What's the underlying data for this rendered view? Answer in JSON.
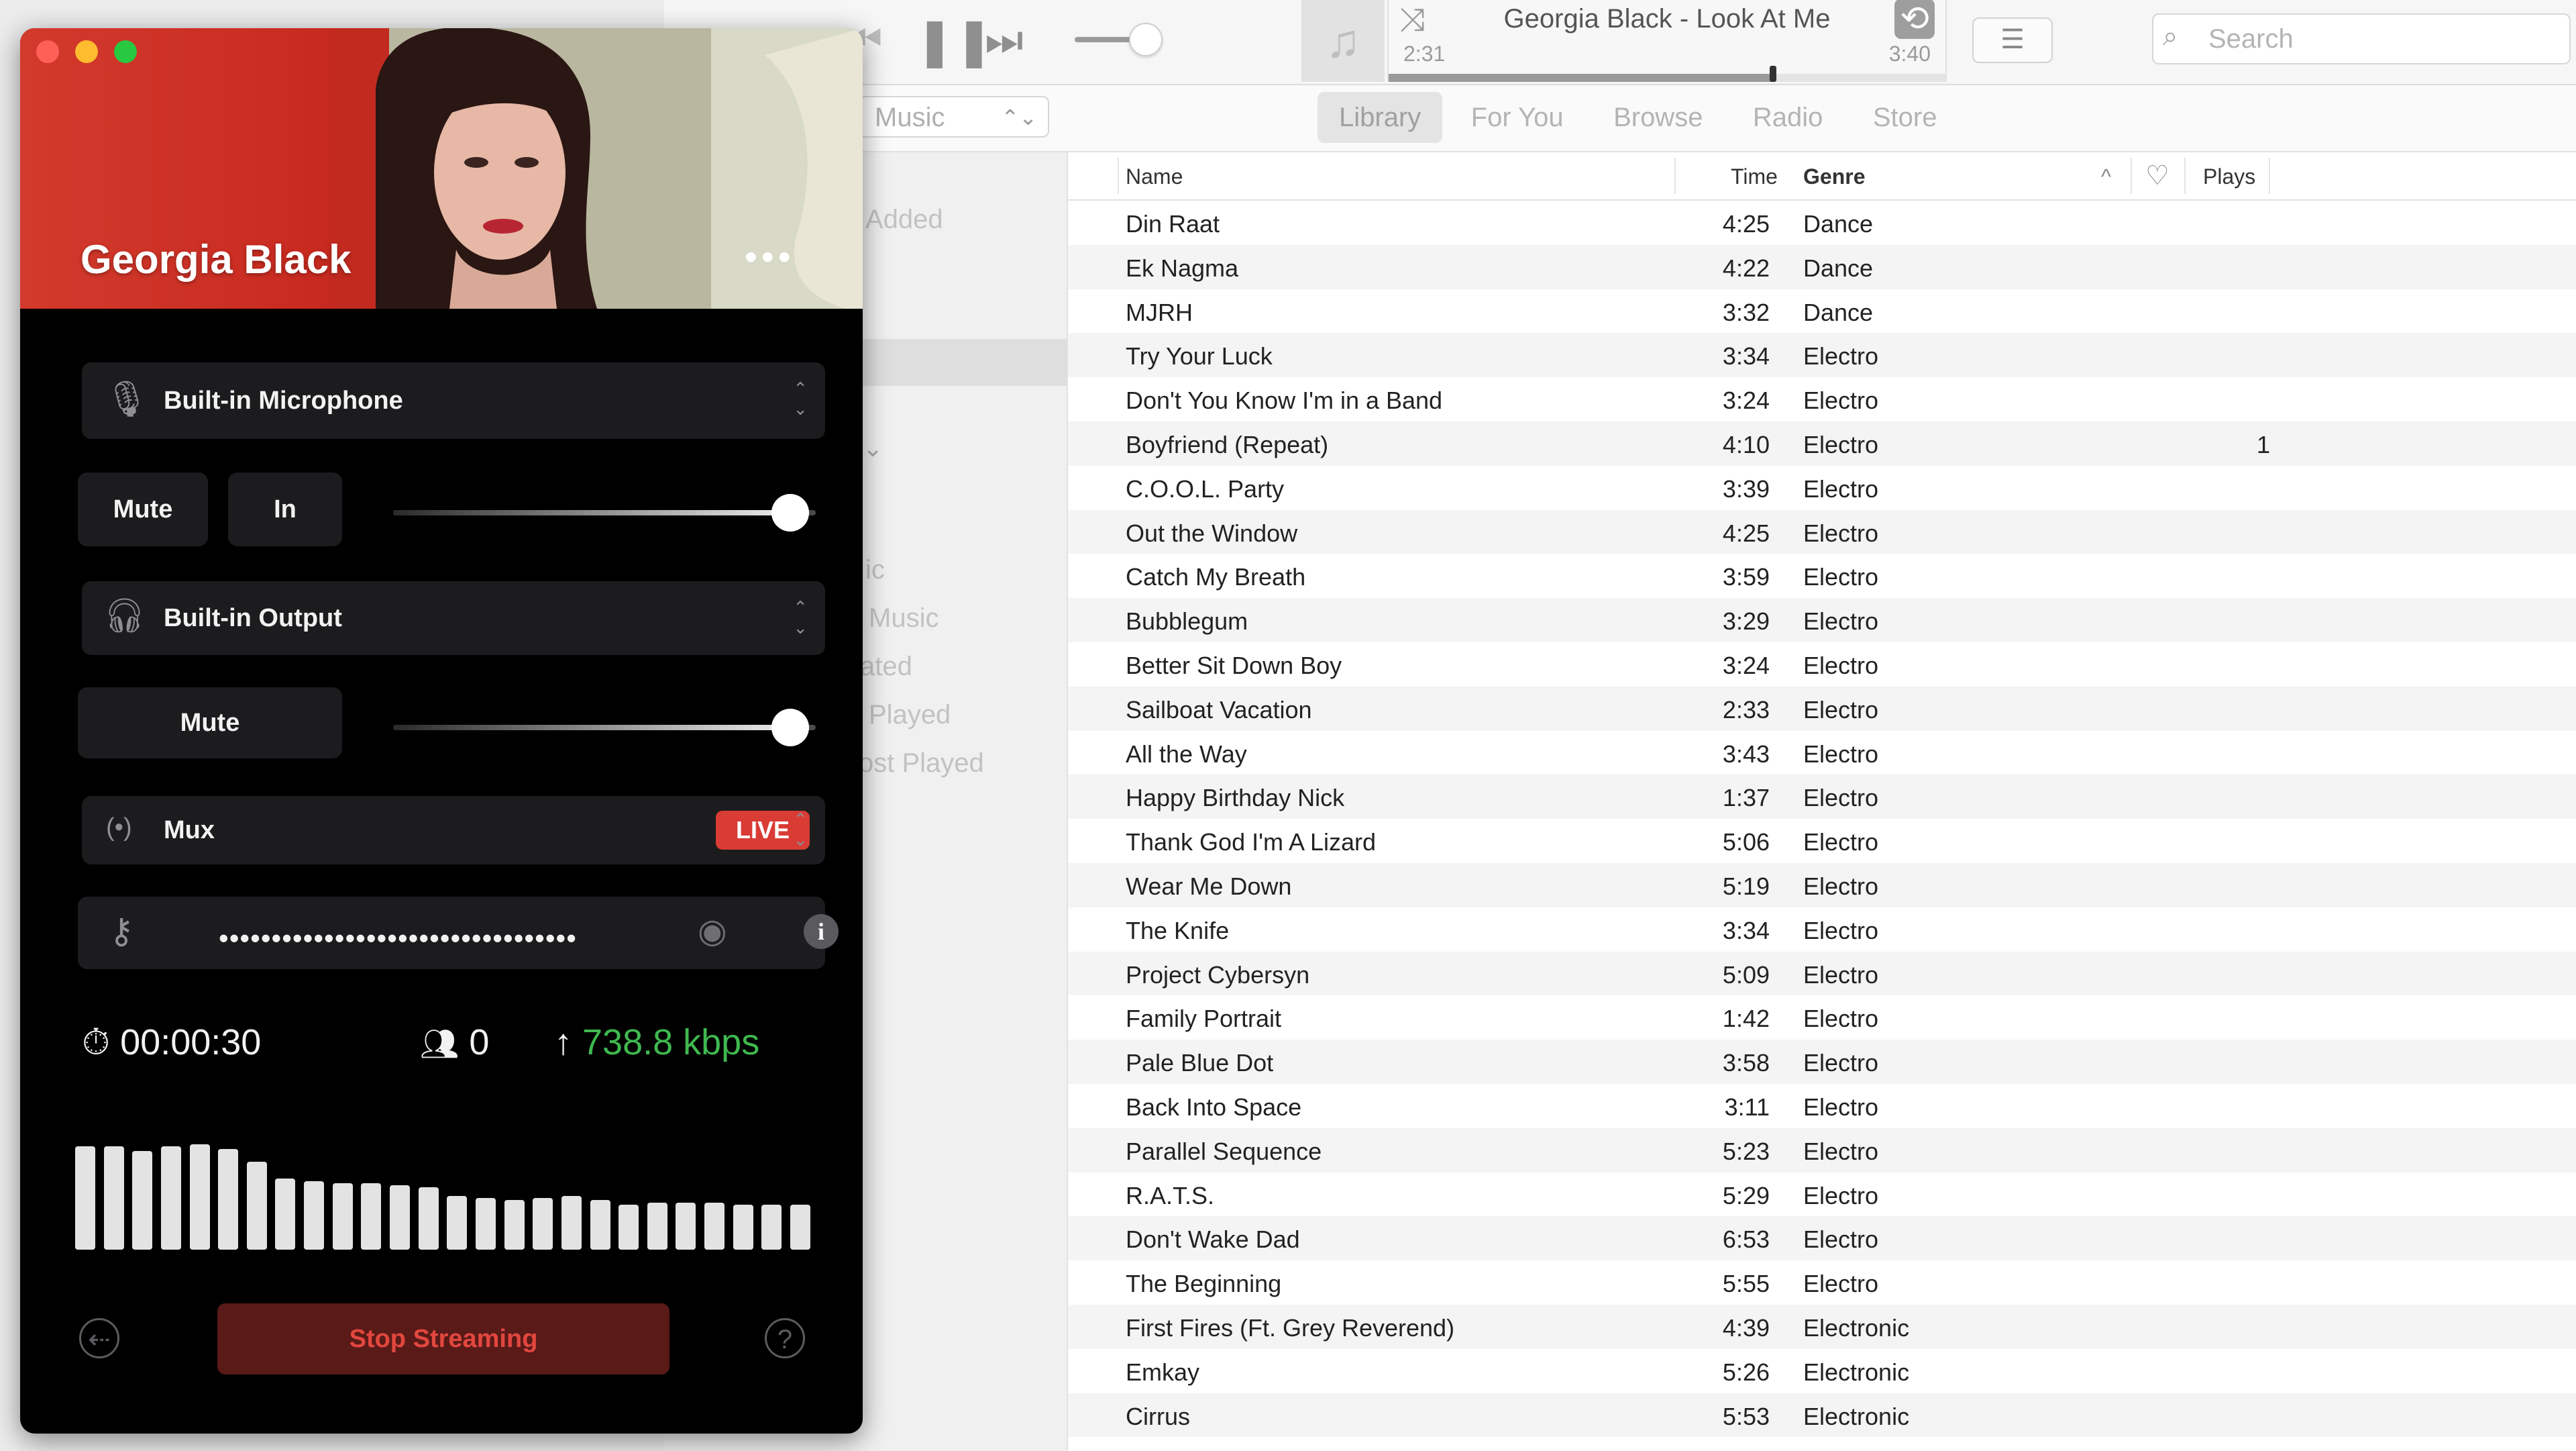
{
  "player": {
    "now_playing": "Georgia Black - Look At Me",
    "elapsed": "2:31",
    "total": "3:40",
    "progress": 0.69,
    "volume": 0.8,
    "search_placeholder": "Search",
    "media_select": "Music"
  },
  "tabs": [
    {
      "label": "Library",
      "active": true
    },
    {
      "label": "For You",
      "active": false
    },
    {
      "label": "Browse",
      "active": false
    },
    {
      "label": "Radio",
      "active": false
    },
    {
      "label": "Store",
      "active": false
    }
  ],
  "sidebar": {
    "items": [
      "Added",
      "ic",
      "Music",
      "ated",
      "Played",
      "ost Played"
    ]
  },
  "table": {
    "columns": {
      "name": "Name",
      "time": "Time",
      "genre": "Genre",
      "plays": "Plays"
    },
    "rows": [
      {
        "name": "Din Raat",
        "time": "4:25",
        "genre": "Dance",
        "plays": ""
      },
      {
        "name": "Ek Nagma",
        "time": "4:22",
        "genre": "Dance",
        "plays": ""
      },
      {
        "name": "MJRH",
        "time": "3:32",
        "genre": "Dance",
        "plays": ""
      },
      {
        "name": "Try Your Luck",
        "time": "3:34",
        "genre": "Electro",
        "plays": ""
      },
      {
        "name": "Don't You Know I'm in a Band",
        "time": "3:24",
        "genre": "Electro",
        "plays": ""
      },
      {
        "name": "Boyfriend (Repeat)",
        "time": "4:10",
        "genre": "Electro",
        "plays": "1"
      },
      {
        "name": "C.O.O.L. Party",
        "time": "3:39",
        "genre": "Electro",
        "plays": ""
      },
      {
        "name": "Out the Window",
        "time": "4:25",
        "genre": "Electro",
        "plays": ""
      },
      {
        "name": "Catch My Breath",
        "time": "3:59",
        "genre": "Electro",
        "plays": ""
      },
      {
        "name": "Bubblegum",
        "time": "3:29",
        "genre": "Electro",
        "plays": ""
      },
      {
        "name": "Better Sit Down Boy",
        "time": "3:24",
        "genre": "Electro",
        "plays": ""
      },
      {
        "name": "Sailboat Vacation",
        "time": "2:33",
        "genre": "Electro",
        "plays": ""
      },
      {
        "name": "All the Way",
        "time": "3:43",
        "genre": "Electro",
        "plays": ""
      },
      {
        "name": "Happy Birthday Nick",
        "time": "1:37",
        "genre": "Electro",
        "plays": ""
      },
      {
        "name": "Thank God I'm A Lizard",
        "time": "5:06",
        "genre": "Electro",
        "plays": ""
      },
      {
        "name": "Wear Me Down",
        "time": "5:19",
        "genre": "Electro",
        "plays": ""
      },
      {
        "name": "The Knife",
        "time": "3:34",
        "genre": "Electro",
        "plays": ""
      },
      {
        "name": "Project Cybersyn",
        "time": "5:09",
        "genre": "Electro",
        "plays": ""
      },
      {
        "name": "Family Portrait",
        "time": "1:42",
        "genre": "Electro",
        "plays": ""
      },
      {
        "name": "Pale Blue Dot",
        "time": "3:58",
        "genre": "Electro",
        "plays": ""
      },
      {
        "name": "Back Into Space",
        "time": "3:11",
        "genre": "Electro",
        "plays": ""
      },
      {
        "name": "Parallel Sequence",
        "time": "5:23",
        "genre": "Electro",
        "plays": ""
      },
      {
        "name": "R.A.T.S.",
        "time": "5:29",
        "genre": "Electro",
        "plays": ""
      },
      {
        "name": "Don't Wake Dad",
        "time": "6:53",
        "genre": "Electro",
        "plays": ""
      },
      {
        "name": "The Beginning",
        "time": "5:55",
        "genre": "Electro",
        "plays": ""
      },
      {
        "name": "First Fires (Ft. Grey Reverend)",
        "time": "4:39",
        "genre": "Electronic",
        "plays": ""
      },
      {
        "name": "Emkay",
        "time": "5:26",
        "genre": "Electronic",
        "plays": ""
      },
      {
        "name": "Cirrus",
        "time": "5:53",
        "genre": "Electronic",
        "plays": ""
      }
    ]
  },
  "stream": {
    "artist": "Georgia Black",
    "input_device": "Built-in Microphone",
    "mute_label": "Mute",
    "in_label": "In",
    "input_level": 0.94,
    "output_device": "Built-in Output",
    "output_mute_label": "Mute",
    "output_level": 0.94,
    "service": "Mux",
    "live_label": "LIVE",
    "stream_key_masked": "••••••••••••••••••••••••••••••••••",
    "elapsed": "00:00:30",
    "listeners": "0",
    "bitrate": "738.8 kbps",
    "meter_levels": [
      0.96,
      0.96,
      0.92,
      0.96,
      0.98,
      0.94,
      0.82,
      0.66,
      0.64,
      0.62,
      0.62,
      0.6,
      0.58,
      0.5,
      0.48,
      0.46,
      0.48,
      0.5,
      0.46,
      0.42,
      0.44,
      0.44,
      0.44,
      0.42,
      0.42,
      0.42
    ],
    "stop_label": "Stop Streaming",
    "colors": {
      "live": "#d93b35",
      "bitrate": "#3fb950",
      "stop_bg": "#5a1a17",
      "stop_text": "#e2473f"
    }
  }
}
